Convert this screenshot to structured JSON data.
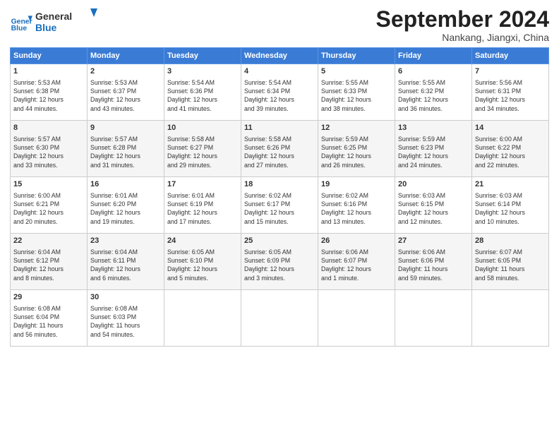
{
  "header": {
    "logo_general": "General",
    "logo_blue": "Blue",
    "month": "September 2024",
    "location": "Nankang, Jiangxi, China"
  },
  "weekdays": [
    "Sunday",
    "Monday",
    "Tuesday",
    "Wednesday",
    "Thursday",
    "Friday",
    "Saturday"
  ],
  "weeks": [
    [
      {
        "day": "1",
        "info": "Sunrise: 5:53 AM\nSunset: 6:38 PM\nDaylight: 12 hours\nand 44 minutes."
      },
      {
        "day": "2",
        "info": "Sunrise: 5:53 AM\nSunset: 6:37 PM\nDaylight: 12 hours\nand 43 minutes."
      },
      {
        "day": "3",
        "info": "Sunrise: 5:54 AM\nSunset: 6:36 PM\nDaylight: 12 hours\nand 41 minutes."
      },
      {
        "day": "4",
        "info": "Sunrise: 5:54 AM\nSunset: 6:34 PM\nDaylight: 12 hours\nand 39 minutes."
      },
      {
        "day": "5",
        "info": "Sunrise: 5:55 AM\nSunset: 6:33 PM\nDaylight: 12 hours\nand 38 minutes."
      },
      {
        "day": "6",
        "info": "Sunrise: 5:55 AM\nSunset: 6:32 PM\nDaylight: 12 hours\nand 36 minutes."
      },
      {
        "day": "7",
        "info": "Sunrise: 5:56 AM\nSunset: 6:31 PM\nDaylight: 12 hours\nand 34 minutes."
      }
    ],
    [
      {
        "day": "8",
        "info": "Sunrise: 5:57 AM\nSunset: 6:30 PM\nDaylight: 12 hours\nand 33 minutes."
      },
      {
        "day": "9",
        "info": "Sunrise: 5:57 AM\nSunset: 6:28 PM\nDaylight: 12 hours\nand 31 minutes."
      },
      {
        "day": "10",
        "info": "Sunrise: 5:58 AM\nSunset: 6:27 PM\nDaylight: 12 hours\nand 29 minutes."
      },
      {
        "day": "11",
        "info": "Sunrise: 5:58 AM\nSunset: 6:26 PM\nDaylight: 12 hours\nand 27 minutes."
      },
      {
        "day": "12",
        "info": "Sunrise: 5:59 AM\nSunset: 6:25 PM\nDaylight: 12 hours\nand 26 minutes."
      },
      {
        "day": "13",
        "info": "Sunrise: 5:59 AM\nSunset: 6:23 PM\nDaylight: 12 hours\nand 24 minutes."
      },
      {
        "day": "14",
        "info": "Sunrise: 6:00 AM\nSunset: 6:22 PM\nDaylight: 12 hours\nand 22 minutes."
      }
    ],
    [
      {
        "day": "15",
        "info": "Sunrise: 6:00 AM\nSunset: 6:21 PM\nDaylight: 12 hours\nand 20 minutes."
      },
      {
        "day": "16",
        "info": "Sunrise: 6:01 AM\nSunset: 6:20 PM\nDaylight: 12 hours\nand 19 minutes."
      },
      {
        "day": "17",
        "info": "Sunrise: 6:01 AM\nSunset: 6:19 PM\nDaylight: 12 hours\nand 17 minutes."
      },
      {
        "day": "18",
        "info": "Sunrise: 6:02 AM\nSunset: 6:17 PM\nDaylight: 12 hours\nand 15 minutes."
      },
      {
        "day": "19",
        "info": "Sunrise: 6:02 AM\nSunset: 6:16 PM\nDaylight: 12 hours\nand 13 minutes."
      },
      {
        "day": "20",
        "info": "Sunrise: 6:03 AM\nSunset: 6:15 PM\nDaylight: 12 hours\nand 12 minutes."
      },
      {
        "day": "21",
        "info": "Sunrise: 6:03 AM\nSunset: 6:14 PM\nDaylight: 12 hours\nand 10 minutes."
      }
    ],
    [
      {
        "day": "22",
        "info": "Sunrise: 6:04 AM\nSunset: 6:12 PM\nDaylight: 12 hours\nand 8 minutes."
      },
      {
        "day": "23",
        "info": "Sunrise: 6:04 AM\nSunset: 6:11 PM\nDaylight: 12 hours\nand 6 minutes."
      },
      {
        "day": "24",
        "info": "Sunrise: 6:05 AM\nSunset: 6:10 PM\nDaylight: 12 hours\nand 5 minutes."
      },
      {
        "day": "25",
        "info": "Sunrise: 6:05 AM\nSunset: 6:09 PM\nDaylight: 12 hours\nand 3 minutes."
      },
      {
        "day": "26",
        "info": "Sunrise: 6:06 AM\nSunset: 6:07 PM\nDaylight: 12 hours\nand 1 minute."
      },
      {
        "day": "27",
        "info": "Sunrise: 6:06 AM\nSunset: 6:06 PM\nDaylight: 11 hours\nand 59 minutes."
      },
      {
        "day": "28",
        "info": "Sunrise: 6:07 AM\nSunset: 6:05 PM\nDaylight: 11 hours\nand 58 minutes."
      }
    ],
    [
      {
        "day": "29",
        "info": "Sunrise: 6:08 AM\nSunset: 6:04 PM\nDaylight: 11 hours\nand 56 minutes."
      },
      {
        "day": "30",
        "info": "Sunrise: 6:08 AM\nSunset: 6:03 PM\nDaylight: 11 hours\nand 54 minutes."
      },
      {
        "day": "",
        "info": ""
      },
      {
        "day": "",
        "info": ""
      },
      {
        "day": "",
        "info": ""
      },
      {
        "day": "",
        "info": ""
      },
      {
        "day": "",
        "info": ""
      }
    ]
  ]
}
